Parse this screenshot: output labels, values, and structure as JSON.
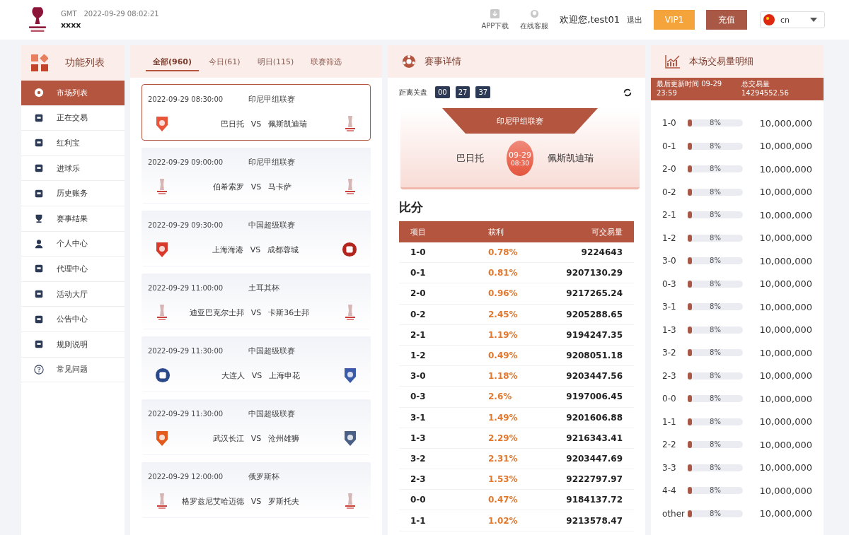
{
  "header": {
    "timezone": "GMT",
    "time": "2022-09-29 08:02:21",
    "username": "xxxx",
    "app_download": "APP下载",
    "support": "在线客服",
    "welcome": "欢迎您,test01",
    "logout": "退出",
    "vip": "VIP1",
    "recharge": "充值",
    "language": "cn"
  },
  "sidebar": {
    "title": "功能列表",
    "items": [
      {
        "label": "市场列表",
        "selected": true
      },
      {
        "label": "正在交易",
        "selected": false
      },
      {
        "label": "红利宝",
        "selected": false
      },
      {
        "label": "进球乐",
        "selected": false
      },
      {
        "label": "历史账务",
        "selected": false
      },
      {
        "label": "赛事结果",
        "selected": false
      },
      {
        "label": "个人中心",
        "selected": false
      },
      {
        "label": "代理中心",
        "selected": false
      },
      {
        "label": "活动大厅",
        "selected": false
      },
      {
        "label": "公告中心",
        "selected": false
      },
      {
        "label": "规则说明",
        "selected": false
      },
      {
        "label": "常见问题",
        "selected": false
      }
    ]
  },
  "tabs": [
    {
      "label": "全部(960)",
      "selected": true
    },
    {
      "label": "今日(61)",
      "selected": false
    },
    {
      "label": "明日(115)",
      "selected": false
    },
    {
      "label": "联赛筛选",
      "selected": false
    }
  ],
  "matches": [
    {
      "time": "2022-09-29 08:30:00",
      "league": "印尼甲组联赛",
      "home": "巴日托",
      "vs": "VS",
      "away": "佩斯凯迪瑞",
      "home_logo": {
        "kind": "badge",
        "color": "#e8553b"
      },
      "away_logo": {
        "kind": "trophy"
      },
      "selected": true
    },
    {
      "time": "2022-09-29 09:00:00",
      "league": "印尼甲组联赛",
      "home": "伯希索罗",
      "vs": "VS",
      "away": "马卡萨",
      "home_logo": {
        "kind": "trophy"
      },
      "away_logo": {
        "kind": "trophy"
      },
      "selected": false
    },
    {
      "time": "2022-09-29 09:30:00",
      "league": "中国超级联赛",
      "home": "上海海港",
      "vs": "VS",
      "away": "成都蓉城",
      "home_logo": {
        "kind": "badge",
        "color": "#d8392a"
      },
      "away_logo": {
        "kind": "round",
        "color": "#b3261e"
      },
      "selected": false
    },
    {
      "time": "2022-09-29 11:00:00",
      "league": "土耳其杯",
      "home": "迪亚巴克尔士邦",
      "vs": "VS",
      "away": "卡斯36士邦",
      "home_logo": {
        "kind": "trophy"
      },
      "away_logo": {
        "kind": "trophy"
      },
      "selected": false
    },
    {
      "time": "2022-09-29 11:30:00",
      "league": "中国超级联赛",
      "home": "大连人",
      "vs": "VS",
      "away": "上海申花",
      "home_logo": {
        "kind": "round",
        "color": "#2b4a8a"
      },
      "away_logo": {
        "kind": "badge",
        "color": "#3a5ba8"
      },
      "selected": false
    },
    {
      "time": "2022-09-29 11:30:00",
      "league": "中国超级联赛",
      "home": "武汉长江",
      "vs": "VS",
      "away": "沧州雄狮",
      "home_logo": {
        "kind": "badge",
        "color": "#e25a1c"
      },
      "away_logo": {
        "kind": "badge",
        "color": "#4a5f86"
      },
      "selected": false
    },
    {
      "time": "2022-09-29 12:00:00",
      "league": "俄罗斯杯",
      "home": "格罗兹尼艾哈迈德",
      "vs": "VS",
      "away": "罗斯托夫",
      "home_logo": {
        "kind": "trophy"
      },
      "away_logo": {
        "kind": "trophy"
      },
      "selected": false
    }
  ],
  "detail": {
    "title": "赛事详情",
    "countdown_label": "距离关盘",
    "countdown": [
      "00",
      "27",
      "37"
    ],
    "league": "印尼甲组联赛",
    "home": "巴日托",
    "away": "佩斯凯迪瑞",
    "date": "09-29",
    "time": "08:30",
    "score_title": "比分",
    "columns": [
      "项目",
      "获利",
      "可交易量"
    ],
    "rows": [
      {
        "score": "1-0",
        "profit": "0.78%",
        "volume": "9224643"
      },
      {
        "score": "0-1",
        "profit": "0.81%",
        "volume": "9207130.29"
      },
      {
        "score": "2-0",
        "profit": "0.96%",
        "volume": "9217265.24"
      },
      {
        "score": "0-2",
        "profit": "2.45%",
        "volume": "9205288.65"
      },
      {
        "score": "2-1",
        "profit": "1.19%",
        "volume": "9194247.35"
      },
      {
        "score": "1-2",
        "profit": "0.49%",
        "volume": "9208051.18"
      },
      {
        "score": "3-0",
        "profit": "1.18%",
        "volume": "9203447.56"
      },
      {
        "score": "0-3",
        "profit": "2.6%",
        "volume": "9197006.45"
      },
      {
        "score": "3-1",
        "profit": "1.49%",
        "volume": "9201606.88"
      },
      {
        "score": "1-3",
        "profit": "2.29%",
        "volume": "9216343.41"
      },
      {
        "score": "3-2",
        "profit": "2.31%",
        "volume": "9203447.69"
      },
      {
        "score": "2-3",
        "profit": "1.53%",
        "volume": "9222797.97"
      },
      {
        "score": "0-0",
        "profit": "0.47%",
        "volume": "9184137.72"
      },
      {
        "score": "1-1",
        "profit": "1.02%",
        "volume": "9213578.47"
      }
    ]
  },
  "volume": {
    "title": "本场交易量明细",
    "updated": "最后更新时间 09-29 23:59",
    "total_label": "总交易量",
    "total": "14294552.56",
    "rows": [
      {
        "score": "1-0",
        "level": 0.08,
        "percent": "8%",
        "amount": "10,000,000"
      },
      {
        "score": "0-1",
        "level": 0.08,
        "percent": "8%",
        "amount": "10,000,000"
      },
      {
        "score": "2-0",
        "level": 0.08,
        "percent": "8%",
        "amount": "10,000,000"
      },
      {
        "score": "0-2",
        "level": 0.08,
        "percent": "8%",
        "amount": "10,000,000"
      },
      {
        "score": "2-1",
        "level": 0.08,
        "percent": "8%",
        "amount": "10,000,000"
      },
      {
        "score": "1-2",
        "level": 0.08,
        "percent": "8%",
        "amount": "10,000,000"
      },
      {
        "score": "3-0",
        "level": 0.08,
        "percent": "8%",
        "amount": "10,000,000"
      },
      {
        "score": "0-3",
        "level": 0.08,
        "percent": "8%",
        "amount": "10,000,000"
      },
      {
        "score": "3-1",
        "level": 0.08,
        "percent": "8%",
        "amount": "10,000,000"
      },
      {
        "score": "1-3",
        "level": 0.08,
        "percent": "8%",
        "amount": "10,000,000"
      },
      {
        "score": "3-2",
        "level": 0.08,
        "percent": "8%",
        "amount": "10,000,000"
      },
      {
        "score": "2-3",
        "level": 0.08,
        "percent": "8%",
        "amount": "10,000,000"
      },
      {
        "score": "0-0",
        "level": 0.08,
        "percent": "8%",
        "amount": "10,000,000"
      },
      {
        "score": "1-1",
        "level": 0.08,
        "percent": "8%",
        "amount": "10,000,000"
      },
      {
        "score": "2-2",
        "level": 0.08,
        "percent": "8%",
        "amount": "10,000,000"
      },
      {
        "score": "3-3",
        "level": 0.08,
        "percent": "8%",
        "amount": "10,000,000"
      },
      {
        "score": "4-4",
        "level": 0.08,
        "percent": "8%",
        "amount": "10,000,000"
      },
      {
        "score": "other",
        "level": 0.08,
        "percent": "8%",
        "amount": "10,000,000"
      }
    ]
  }
}
